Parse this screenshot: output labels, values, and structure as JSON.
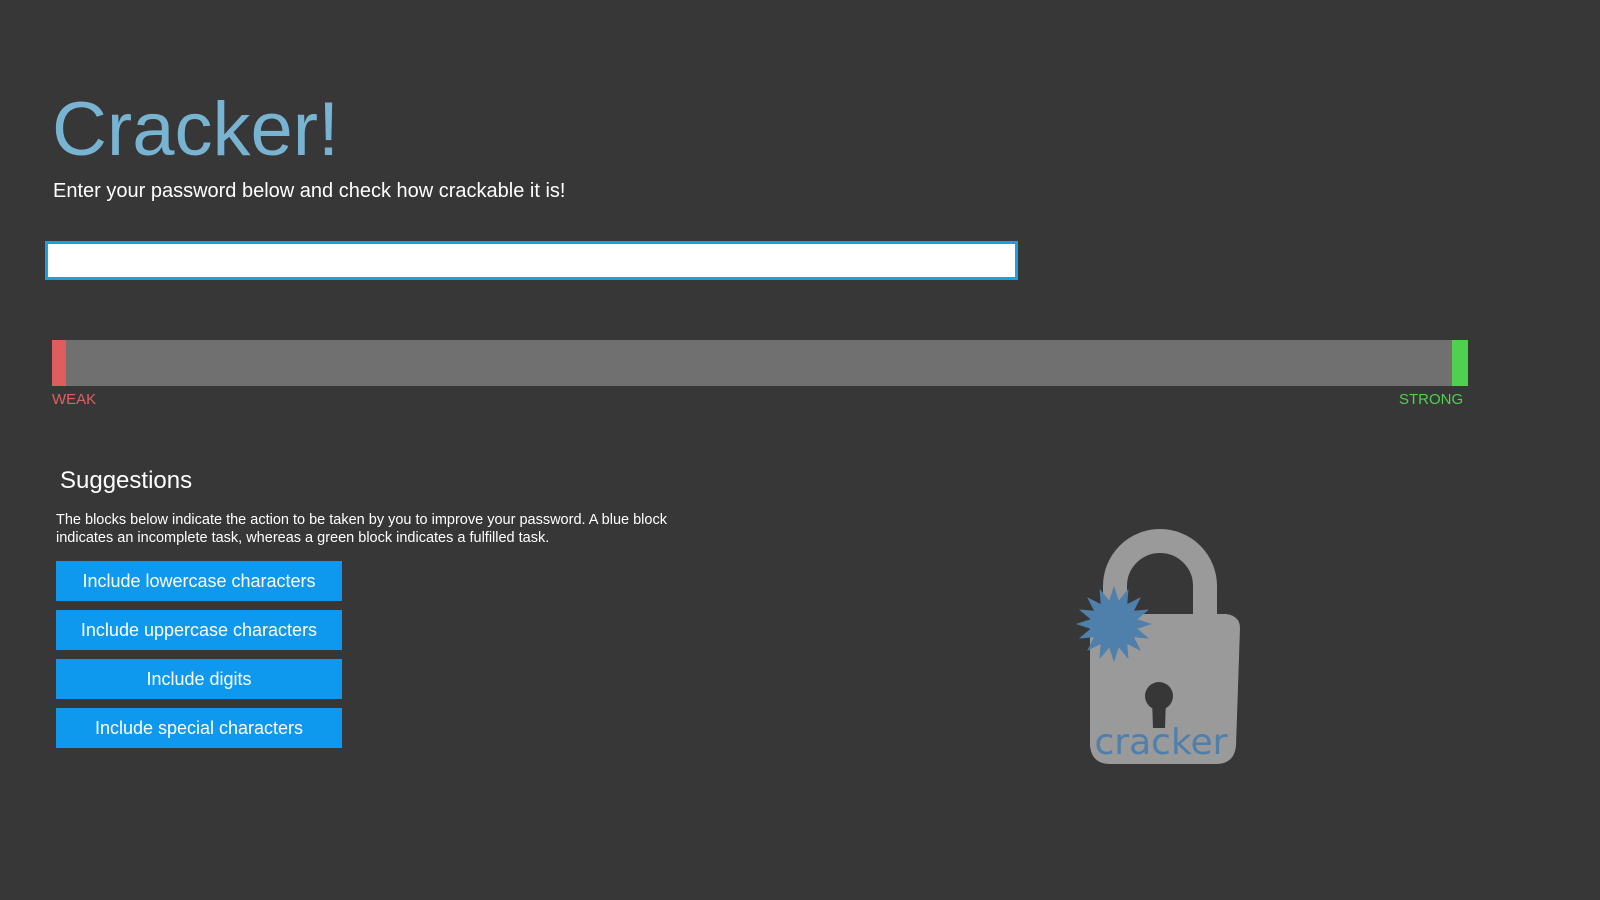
{
  "app": {
    "title": "Cracker!",
    "subtitle": "Enter your password below and check how crackable it is!"
  },
  "password_input": {
    "value": "",
    "placeholder": ""
  },
  "strength_meter": {
    "fraction": 0.01,
    "weak_label": "WEAK",
    "strong_label": "STRONG",
    "weak_color": "#e05d5d",
    "strong_color": "#4fd14f",
    "track_color": "#707070"
  },
  "suggestions": {
    "title": "Suggestions",
    "description": "The blocks below indicate the action to be taken by you to improve your password. A blue block indicates an incomplete task, whereas a green block indicates a fulfilled task.",
    "incomplete_color": "#0e98ee",
    "items": [
      {
        "label": "Include lowercase characters",
        "status": "incomplete"
      },
      {
        "label": "Include uppercase characters",
        "status": "incomplete"
      },
      {
        "label": "Include digits",
        "status": "incomplete"
      },
      {
        "label": "Include special characters",
        "status": "incomplete"
      }
    ]
  },
  "logo": {
    "icon": "padlock-icon",
    "text": "cracker"
  },
  "colors": {
    "background": "#373737",
    "title": "#78b4d2",
    "input_border": "#1a9fe0"
  }
}
